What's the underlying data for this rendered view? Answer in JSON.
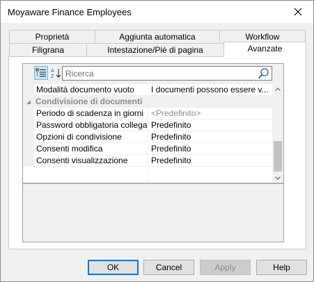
{
  "window": {
    "title": "Moyaware Finance Employees"
  },
  "tabs": {
    "row1": [
      "Proprietà",
      "Aggiunta automatica",
      "Workflow"
    ],
    "row2": [
      "Filigrana",
      "Intestazione/Piè di pagina",
      "Avanzate"
    ],
    "active": "Avanzate"
  },
  "toolbar": {
    "search_placeholder": "Ricerca"
  },
  "grid": {
    "rows": [
      {
        "name": "Modalità documento vuoto",
        "value": "I documenti possono essere v..."
      },
      {
        "category": "Condivisione di documenti"
      },
      {
        "name": "Periodo di scadenza in giorni",
        "value": "<Predefinito>",
        "placeholder": true
      },
      {
        "name": "Password obbligatoria collega...",
        "value": "Predefinito"
      },
      {
        "name": "Opzioni di condivisione",
        "value": "Predefinito"
      },
      {
        "name": "Consenti modifica",
        "value": "Predefinito"
      },
      {
        "name": "Consenti visualizzazione",
        "value": "Predefinito"
      }
    ]
  },
  "buttons": {
    "ok": "OK",
    "cancel": "Cancel",
    "apply": "Apply",
    "help": "Help"
  },
  "colors": {
    "accent": "#0078d7",
    "selected_tool_bg": "#cce4f7",
    "category_text": "#8c8c8c"
  }
}
